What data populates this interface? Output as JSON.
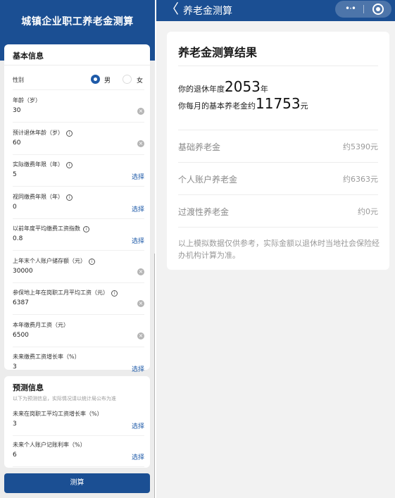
{
  "left": {
    "title": "城镇企业职工养老金测算",
    "basic": {
      "heading": "基本信息",
      "gender_label": "性别",
      "gender_options": [
        "男",
        "女"
      ],
      "fields": [
        {
          "label": "年龄（岁）",
          "value": "30",
          "info": false,
          "action": "clear"
        },
        {
          "label": "预计退休年龄（岁）",
          "value": "60",
          "info": true,
          "action": "clear"
        },
        {
          "label": "实际缴费年限（年）",
          "value": "5",
          "info": true,
          "action": "select"
        },
        {
          "label": "视同缴费年限（年）",
          "value": "0",
          "info": true,
          "action": "select"
        },
        {
          "label": "以前年度平均缴费工资指数",
          "value": "0.8",
          "info": true,
          "action": "select"
        },
        {
          "label": "上年末个人账户储存额（元）",
          "value": "30000",
          "info": true,
          "action": "clear"
        },
        {
          "label": "参保地上年在岗职工月平均工资（元）",
          "value": "6387",
          "info": true,
          "action": "clear"
        },
        {
          "label": "本年缴费月工资（元）",
          "value": "6500",
          "info": false,
          "action": "clear"
        },
        {
          "label": "未来缴费工资增长率（%）",
          "value": "3",
          "info": false,
          "action": "select"
        }
      ]
    },
    "predict": {
      "heading": "预测信息",
      "subtitle": "以下为预测信息，实际情况请以统计局公布为准",
      "fields": [
        {
          "label": "未来在岗职工平均工资增长率（%）",
          "value": "3",
          "action": "select"
        },
        {
          "label": "未来个人账户记账利率（%）",
          "value": "6",
          "action": "select"
        }
      ]
    },
    "select_label": "选择",
    "info_glyph": "i",
    "clear_glyph": "×",
    "calc_button": "测算"
  },
  "right": {
    "nav_title": "养老金测算",
    "back_glyph": "〈",
    "more_glyph": "•·•",
    "result": {
      "title": "养老金测算结果",
      "retire_prefix": "你的退休年度",
      "retire_year": "2053",
      "retire_suffix": "年",
      "monthly_prefix": "你每月的基本养老金约",
      "monthly_amount": "11753",
      "monthly_suffix": "元",
      "items": [
        {
          "label": "基础养老金",
          "value": "约5390元"
        },
        {
          "label": "个人账户养老金",
          "value": "约6363元"
        },
        {
          "label": "过渡性养老金",
          "value": "约0元"
        }
      ],
      "note": "以上模拟数据仅供参考，实际金额以退休时当地社会保险经办机构计算为准。"
    }
  },
  "colors": {
    "brand": "#1b4f93",
    "link": "#1e5aa8",
    "background": "#ececec"
  }
}
